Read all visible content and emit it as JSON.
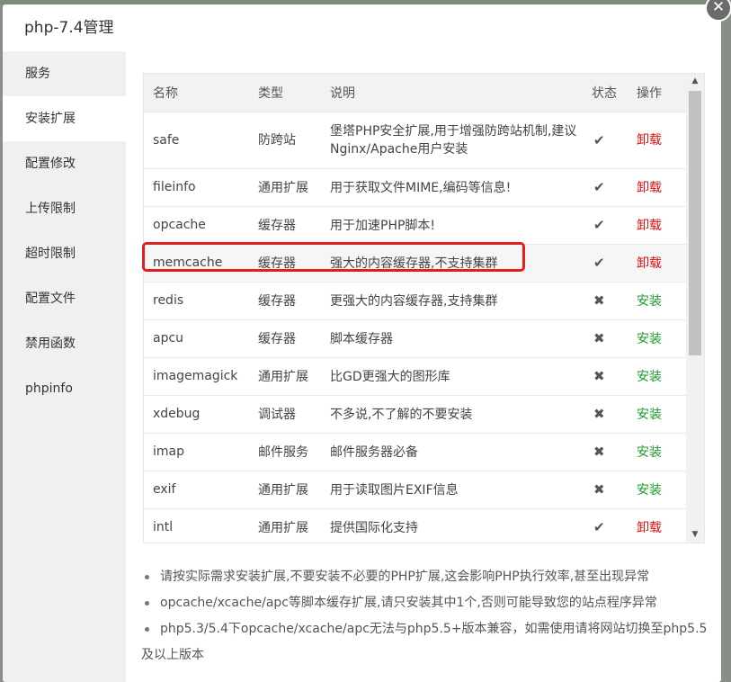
{
  "dialog": {
    "title": "php-7.4管理",
    "close_glyph": "✕"
  },
  "sidebar": {
    "items": [
      {
        "label": "服务"
      },
      {
        "label": "安装扩展"
      },
      {
        "label": "配置修改"
      },
      {
        "label": "上传限制"
      },
      {
        "label": "超时限制"
      },
      {
        "label": "配置文件"
      },
      {
        "label": "禁用函数"
      },
      {
        "label": "phpinfo"
      }
    ],
    "active_index": 1
  },
  "table": {
    "headers": {
      "name": "名称",
      "type": "类型",
      "desc": "说明",
      "status": "状态",
      "action": "操作"
    },
    "rows": [
      {
        "name": "safe",
        "type": "防跨站",
        "desc": "堡塔PHP安全扩展,用于增强防跨站机制,建议Nginx/Apache用户安装",
        "status": "✔",
        "action": "卸载"
      },
      {
        "name": "fileinfo",
        "type": "通用扩展",
        "desc": "用于获取文件MIME,编码等信息!",
        "status": "✔",
        "action": "卸载"
      },
      {
        "name": "opcache",
        "type": "缓存器",
        "desc": "用于加速PHP脚本!",
        "status": "✔",
        "action": "卸载"
      },
      {
        "name": "memcache",
        "type": "缓存器",
        "desc": "强大的内容缓存器,不支持集群",
        "status": "✔",
        "action": "卸载"
      },
      {
        "name": "redis",
        "type": "缓存器",
        "desc": "更强大的内容缓存器,支持集群",
        "status": "✖",
        "action": "安装"
      },
      {
        "name": "apcu",
        "type": "缓存器",
        "desc": "脚本缓存器",
        "status": "✖",
        "action": "安装"
      },
      {
        "name": "imagemagick",
        "type": "通用扩展",
        "desc": "比GD更强大的图形库",
        "status": "✖",
        "action": "安装"
      },
      {
        "name": "xdebug",
        "type": "调试器",
        "desc": "不多说,不了解的不要安装",
        "status": "✖",
        "action": "安装"
      },
      {
        "name": "imap",
        "type": "邮件服务",
        "desc": "邮件服务器必备",
        "status": "✖",
        "action": "安装"
      },
      {
        "name": "exif",
        "type": "通用扩展",
        "desc": "用于读取图片EXIF信息",
        "status": "✖",
        "action": "安装"
      },
      {
        "name": "intl",
        "type": "通用扩展",
        "desc": "提供国际化支持",
        "status": "✔",
        "action": "卸载"
      }
    ]
  },
  "scrollbar": {
    "up_glyph": "▲",
    "down_glyph": "▼"
  },
  "notes": [
    "请按实际需求安装扩展,不要安装不必要的PHP扩展,这会影响PHP执行效率,甚至出现异常",
    "opcache/xcache/apc等脚本缓存扩展,请只安装其中1个,否则可能导致您的站点程序异常",
    "php5.3/5.4下opcache/xcache/apc无法与php5.5+版本兼容，如需使用请将网站切换至php5.5及以上版本"
  ],
  "colors": {
    "uninstall": "#e01212",
    "install": "#1d9b2b",
    "highlight": "#e02020"
  }
}
